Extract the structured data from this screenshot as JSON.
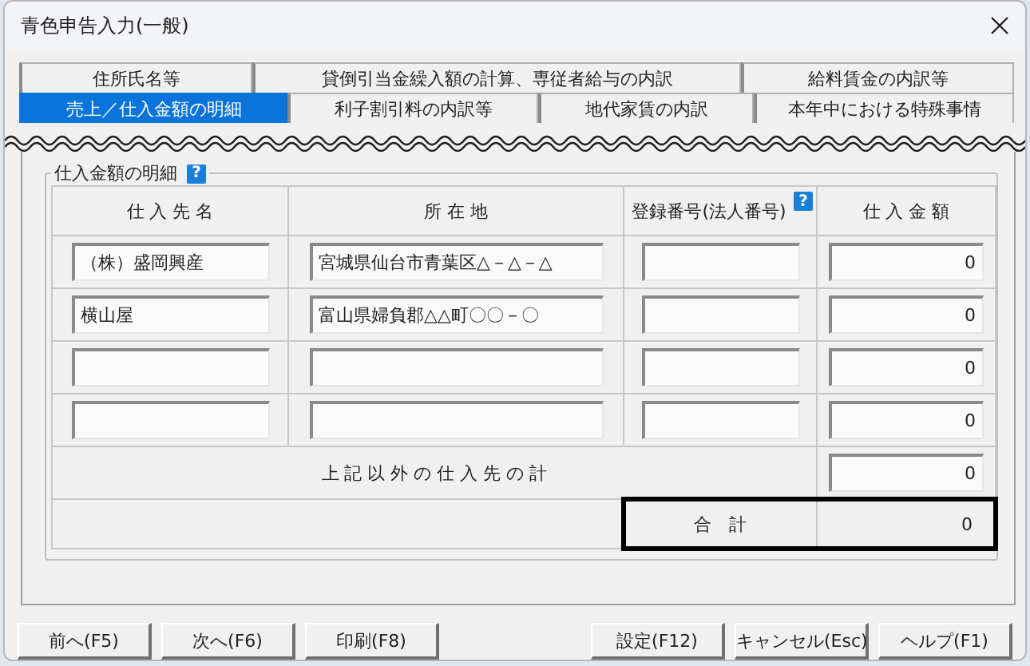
{
  "window": {
    "title": "青色申告入力(一般)"
  },
  "tabs": [
    [
      {
        "label": "住所氏名等",
        "selected": false
      },
      {
        "label": "貸倒引当金繰入額の計算、専従者給与の内訳",
        "selected": false
      },
      {
        "label": "給料賃金の内訳等",
        "selected": false
      }
    ],
    [
      {
        "label": "売上／仕入金額の明細",
        "selected": true
      },
      {
        "label": "利子割引料の内訳等",
        "selected": false
      },
      {
        "label": "地代家賃の内訳",
        "selected": false
      },
      {
        "label": "本年中における特殊事情",
        "selected": false
      }
    ]
  ],
  "section": {
    "title": "仕入金額の明細",
    "help": "?"
  },
  "columns": [
    {
      "label": "仕 入 先 名"
    },
    {
      "label": "所 在 地"
    },
    {
      "label": "登録番号(法人番号)",
      "help": "?"
    },
    {
      "label": "仕 入 金 額"
    }
  ],
  "rows": [
    {
      "name": "（株）盛岡興産",
      "address": "宮城県仙台市青葉区△－△－△",
      "registration": "",
      "amount": "0"
    },
    {
      "name": "横山屋",
      "address": "富山県婦負郡△△町〇〇－〇",
      "registration": "",
      "amount": "0"
    },
    {
      "name": "",
      "address": "",
      "registration": "",
      "amount": "0"
    },
    {
      "name": "",
      "address": "",
      "registration": "",
      "amount": "0"
    }
  ],
  "other": {
    "label": "上 記 以 外 の 仕 入 先 の 計",
    "amount": "0"
  },
  "total": {
    "label": "合　計",
    "amount": "0"
  },
  "buttons_left": [
    "前へ(F5)",
    "次へ(F6)",
    "印刷(F8)"
  ],
  "buttons_right": [
    "設定(F12)",
    "キャンセル(Esc)",
    "ヘルプ(F1)"
  ]
}
